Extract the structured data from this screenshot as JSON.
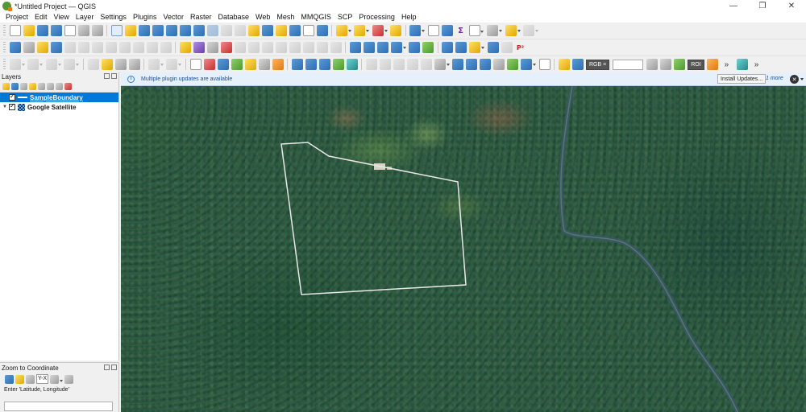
{
  "window": {
    "title": "*Untitled Project — QGIS",
    "controls": {
      "minimize": "—",
      "maximize": "❐",
      "close": "✕"
    }
  },
  "menu": [
    "Project",
    "Edit",
    "View",
    "Layer",
    "Settings",
    "Plugins",
    "Vector",
    "Raster",
    "Database",
    "Web",
    "Mesh",
    "MMQGIS",
    "SCP",
    "Processing",
    "Help"
  ],
  "toolbars": {
    "rgb_label": "RGB =",
    "band_combo": "",
    "roi_label": "ROI",
    "more": "»",
    "sigma_icon": "Σ",
    "p2_icon": "P²"
  },
  "layers_panel": {
    "title": "Layers",
    "layers": [
      {
        "name": "SampleBoundary",
        "checked": true,
        "selected": true,
        "type": "vector-line"
      },
      {
        "name": "Google Satellite",
        "checked": true,
        "selected": false,
        "type": "raster-xyz"
      }
    ]
  },
  "zoom_panel": {
    "title": "Zoom to Coordinate",
    "yx_label": "Y-X",
    "hint": "Enter 'Latitude, Longitude'",
    "input_value": ""
  },
  "message_bar": {
    "text": "Multiple plugin updates are available",
    "button": "Install Updates...",
    "more": "1 more",
    "close_glyph": "✕"
  },
  "colors": {
    "accent": "#0078d7",
    "boundary_stroke": "#e8e8e8",
    "river": "#3d5a66",
    "message_bg": "#e6f0fa"
  }
}
